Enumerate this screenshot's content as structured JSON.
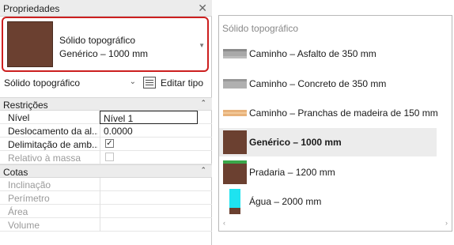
{
  "properties": {
    "title": "Propriedades",
    "close": "✕",
    "type_selector": {
      "line1": "Sólido topográfico",
      "line2": "Genérico – 1000 mm",
      "arrow": "▼"
    },
    "type_filter": {
      "label": "Sólido topográfico",
      "chevron": "⌄",
      "edit_type": "Editar tipo"
    },
    "sections": {
      "restricoes": "Restrições",
      "cotas": "Cotas",
      "collapse": "⌃"
    },
    "params": {
      "nivel": {
        "name": "Nível",
        "value": "Nível 1"
      },
      "deslocamento": {
        "name": "Deslocamento da al...",
        "value": "0.0000"
      },
      "delimitacao": {
        "name": "Delimitação de amb...",
        "checked": "✓"
      },
      "relativo": {
        "name": "Relativo à massa"
      },
      "inclinacao": {
        "name": "Inclinação"
      },
      "perimetro": {
        "name": "Perímetro"
      },
      "area": {
        "name": "Área"
      },
      "volume": {
        "name": "Volume"
      }
    }
  },
  "type_list": {
    "header": "Sólido topográfico",
    "items": [
      {
        "label": "Caminho – Asfalto de 350 mm",
        "icon": "asphalt-swatch"
      },
      {
        "label": "Caminho – Concreto de 350 mm",
        "icon": "concrete-swatch"
      },
      {
        "label": "Caminho – Pranchas de madeira de 150 mm",
        "icon": "wood-swatch"
      },
      {
        "label": "Genérico – 1000 mm",
        "icon": "generic-swatch",
        "selected": true
      },
      {
        "label": "Pradaria – 1200 mm",
        "icon": "grass-swatch"
      },
      {
        "label": "Água – 2000 mm",
        "icon": "water-swatch"
      }
    ],
    "scroll_left": "‹",
    "scroll_right": "›"
  },
  "colors": {
    "accent_highlight": "#cc1f1f",
    "earth": "#6b4030",
    "water": "#1ee3f0",
    "grass": "#3aa84a",
    "wood": "#e8b27a"
  }
}
